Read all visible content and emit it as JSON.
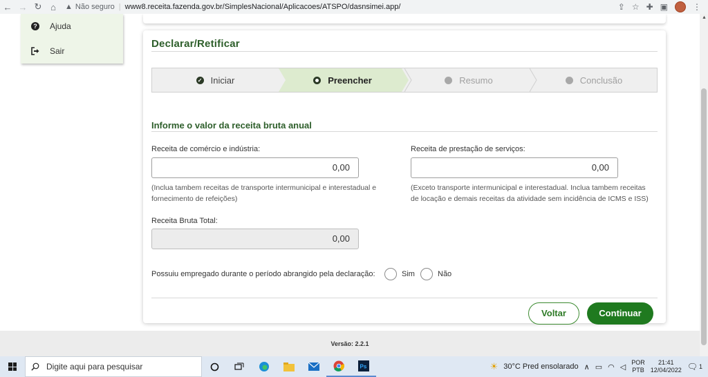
{
  "browser": {
    "back_glyph": "←",
    "forward_glyph": "→",
    "reload_glyph": "↻",
    "home_glyph": "⌂",
    "security_label": "Não seguro",
    "separator": "|",
    "url": "www8.receita.fazenda.gov.br/SimplesNacional/Aplicacoes/ATSPO/dasnsimei.app/"
  },
  "sidebar": {
    "items": [
      {
        "label": "Ajuda",
        "icon": "help-icon"
      },
      {
        "label": "Sair",
        "icon": "exit-icon"
      }
    ]
  },
  "form": {
    "title": "Declarar/Retificar",
    "steps": [
      {
        "label": "Iniciar",
        "state": "done"
      },
      {
        "label": "Preencher",
        "state": "active"
      },
      {
        "label": "Resumo",
        "state": "pending"
      },
      {
        "label": "Conclusão",
        "state": "pending"
      }
    ],
    "section_title": "Informe o valor da receita bruta anual",
    "commerce": {
      "label": "Receita de comércio e indústria:",
      "value": "0,00",
      "hint_line1": "(Inclua tambem receitas de transporte intermunicipal e interestadual e",
      "hint_line2": "fornecimento de refeições)"
    },
    "services": {
      "label": "Receita de prestação de serviços:",
      "value": "0,00",
      "hint_line1": "(Exceto transporte intermunicipal e interestadual. Inclua tambem receitas",
      "hint_line2": "de locação e demais receitas da atividade sem incidência de ICMS e ISS)"
    },
    "total": {
      "label": "Receita Bruta Total:",
      "value": "0,00"
    },
    "employee_question": "Possuiu empregado durante o período abrangido pela declaração:",
    "yes_label": "Sim",
    "no_label": "Não",
    "back_button": "Voltar",
    "continue_button": "Continuar"
  },
  "footer": {
    "version": "Versão: 2.2.1"
  },
  "taskbar": {
    "search_placeholder": "Digite aqui para pesquisar",
    "weather": "30°C  Pred ensolarado",
    "lang_line1": "POR",
    "lang_line2": "PTB",
    "time": "21:41",
    "date": "12/04/2022",
    "notification_count": "1"
  },
  "colors": {
    "brand_green": "#2d5e2a",
    "button_green": "#1f7a1f",
    "active_step": "#ddebcf"
  }
}
